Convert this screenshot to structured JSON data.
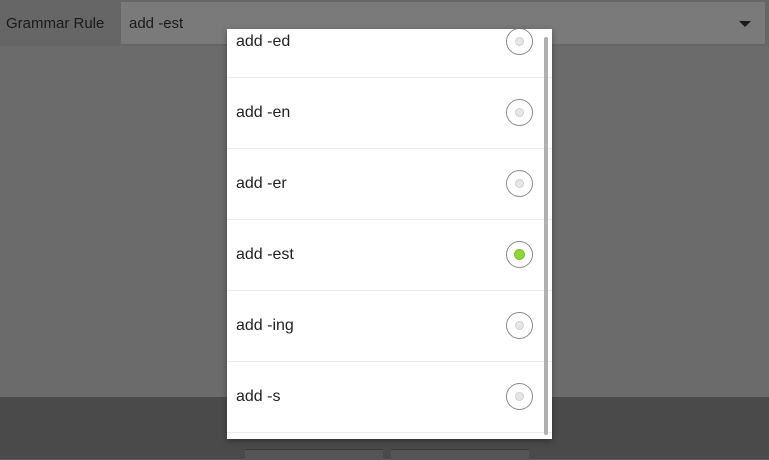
{
  "form": {
    "label": "Grammar Rule",
    "selected_value": "add -est"
  },
  "dialog": {
    "options": [
      {
        "label": "add -ed",
        "checked": false
      },
      {
        "label": "add -en",
        "checked": false
      },
      {
        "label": "add -er",
        "checked": false
      },
      {
        "label": "add -est",
        "checked": true
      },
      {
        "label": "add -ing",
        "checked": false
      },
      {
        "label": "add -s",
        "checked": false
      }
    ]
  },
  "colors": {
    "accent_checked": "#8fd438",
    "dim_overlay": "#6b6b6b"
  },
  "icons": {
    "dropdown": "triangle-down-icon"
  }
}
